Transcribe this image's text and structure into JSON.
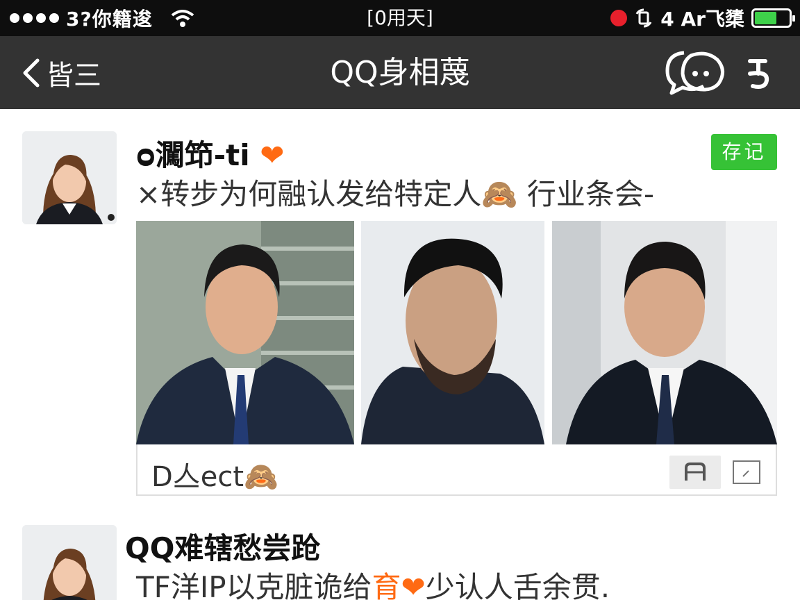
{
  "status_bar": {
    "carrier": "3?你籍逡",
    "center_text": "[0用天]",
    "right_label": "4 Ar飞橥",
    "battery_level": 0.6,
    "colors": {
      "record": "#e8202c",
      "battery": "#3ed14a"
    },
    "icons": [
      "signal-dots-icon",
      "wifi-icon",
      "record-dot-icon",
      "rotation-lock-icon",
      "battery-icon"
    ]
  },
  "nav": {
    "back_label": "皆三",
    "title": "QQ身相蔑",
    "icons": [
      "back-chevron-icon",
      "chat-bubble-icon",
      "more-icon"
    ]
  },
  "posts": [
    {
      "name": "ᴑ㶒笻-ti",
      "heart": "❤",
      "tag": "存记",
      "text_prefix": "×转步为何融认发给特定人",
      "text_emoji": "🙈",
      "text_suffix": " 行业条会-",
      "images": [
        "portrait-man-suit-1",
        "portrait-man-beard",
        "portrait-man-suit-2"
      ],
      "link_text": "D亼ect",
      "link_emoji": "🙈"
    },
    {
      "name": "QQ难辖愁尝跄",
      "text_prefix": "TF洋IP以克脏诡给",
      "text_highlight": "育",
      "heart": "❤",
      "text_suffix": "少认人舌余贯."
    }
  ],
  "colors": {
    "navbar": "#333333",
    "tag": "#36c236",
    "accent": "#ff6a13"
  }
}
